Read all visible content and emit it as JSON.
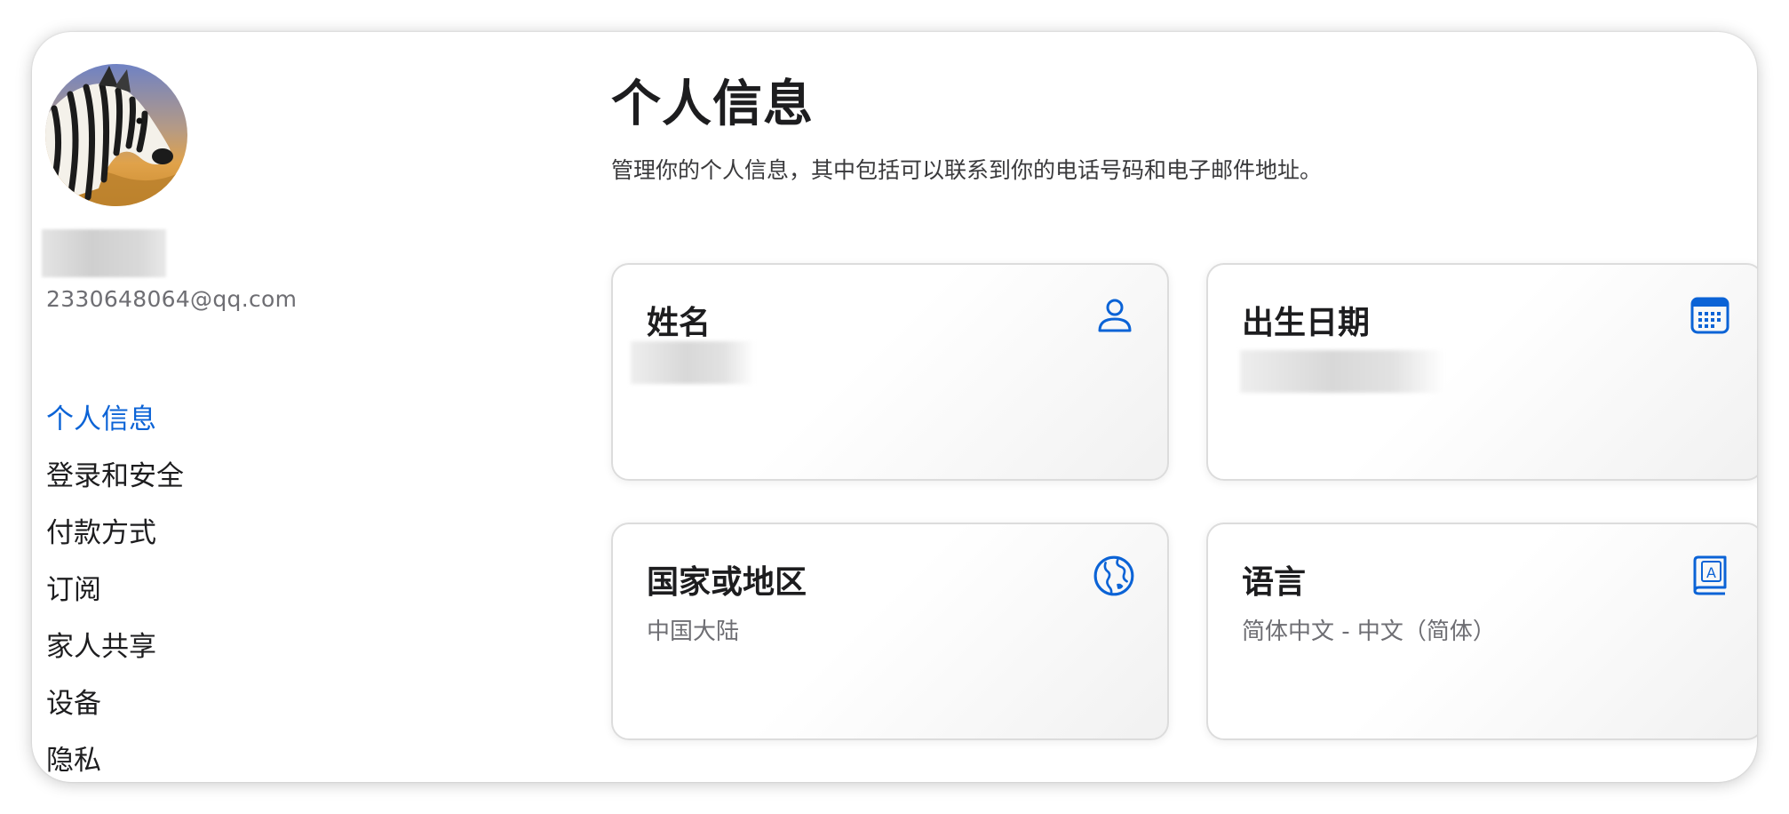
{
  "profile": {
    "email": "2330648064@qq.com",
    "avatar_icon": "zebra-avatar"
  },
  "nav": {
    "items": [
      {
        "label": "个人信息",
        "active": true
      },
      {
        "label": "登录和安全"
      },
      {
        "label": "付款方式"
      },
      {
        "label": "订阅"
      },
      {
        "label": "家人共享"
      },
      {
        "label": "设备"
      },
      {
        "label": "隐私"
      }
    ]
  },
  "main": {
    "title": "个人信息",
    "description": "管理你的个人信息，其中包括可以联系到你的电话号码和电子邮件地址。",
    "cards": [
      {
        "title": "姓名",
        "value": "",
        "icon": "person-icon"
      },
      {
        "title": "出生日期",
        "value": "",
        "icon": "calendar-icon"
      },
      {
        "title": "国家或地区",
        "value": "中国大陆",
        "icon": "globe-icon"
      },
      {
        "title": "语言",
        "value": "简体中文 - 中文（简体）",
        "icon": "language-book-icon"
      }
    ]
  },
  "colors": {
    "accent": "#0b63d6",
    "text": "#1d1d1f",
    "secondary_text": "#6e6e73"
  }
}
